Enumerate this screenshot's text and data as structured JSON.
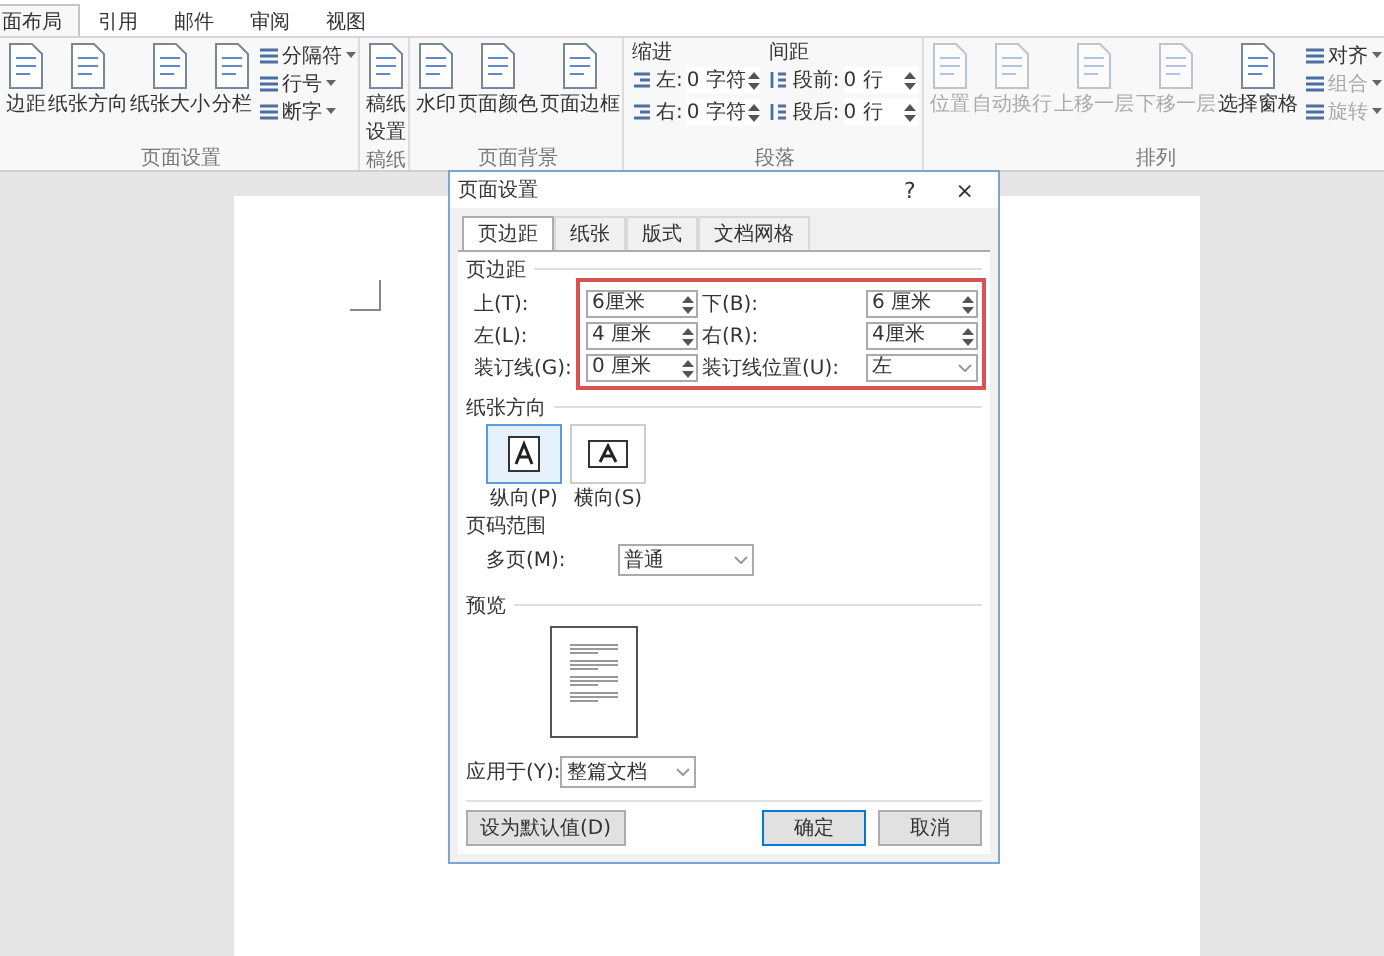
{
  "ribbon_tabs": [
    {
      "label": "面布局",
      "selected": true
    },
    {
      "label": "引用",
      "selected": false
    },
    {
      "label": "邮件",
      "selected": false
    },
    {
      "label": "审阅",
      "selected": false
    },
    {
      "label": "视图",
      "selected": false
    }
  ],
  "ribbon": {
    "page_setup": {
      "title": "页面设置",
      "large": [
        {
          "label": "边距",
          "disabled": false
        },
        {
          "label": "纸张方向",
          "disabled": false
        },
        {
          "label": "纸张大小",
          "disabled": false
        },
        {
          "label": "分栏",
          "disabled": false
        }
      ],
      "small": [
        {
          "label": "分隔符",
          "disabled": false
        },
        {
          "label": "行号",
          "disabled": false
        },
        {
          "label": "断字",
          "disabled": false
        }
      ]
    },
    "manuscript": {
      "title": "稿纸",
      "large": [
        {
          "label": "稿纸设置",
          "disabled": false
        }
      ]
    },
    "page_background": {
      "title": "页面背景",
      "large": [
        {
          "label": "水印",
          "disabled": false
        },
        {
          "label": "页面颜色",
          "disabled": false
        },
        {
          "label": "页面边框",
          "disabled": false
        }
      ]
    },
    "paragraph": {
      "title": "段落",
      "indent_title": "缩进",
      "spacing_title": "间距",
      "indent": [
        {
          "label": "左:",
          "value": "0 字符"
        },
        {
          "label": "右:",
          "value": "0 字符"
        }
      ],
      "spacing": [
        {
          "label": "段前:",
          "value": "0 行"
        },
        {
          "label": "段后:",
          "value": "0 行"
        }
      ]
    },
    "arrange": {
      "title": "排列",
      "large": [
        {
          "label": "位置",
          "disabled": true
        },
        {
          "label": "自动换行",
          "disabled": true
        },
        {
          "label": "上移一层",
          "disabled": true
        },
        {
          "label": "下移一层",
          "disabled": true
        },
        {
          "label": "选择窗格",
          "disabled": false
        }
      ],
      "small": [
        {
          "label": "对齐",
          "disabled": false
        },
        {
          "label": "组合",
          "disabled": true
        },
        {
          "label": "旋转",
          "disabled": true
        }
      ]
    }
  },
  "dialog": {
    "title": "页面设置",
    "help": "?",
    "close": "×",
    "tabs": [
      {
        "label": "页边距",
        "selected": true
      },
      {
        "label": "纸张",
        "selected": false
      },
      {
        "label": "版式",
        "selected": false
      },
      {
        "label": "文档网格",
        "selected": false
      }
    ],
    "margins": {
      "title": "页边距",
      "fields": [
        {
          "label": "上(T):",
          "value": "6厘米",
          "kind": "spin"
        },
        {
          "label": "下(B):",
          "value": "6 厘米",
          "kind": "spin"
        },
        {
          "label": "左(L):",
          "value": "4 厘米",
          "kind": "spin"
        },
        {
          "label": "右(R):",
          "value": "4厘米",
          "kind": "spin"
        },
        {
          "label": "装订线(G):",
          "value": "0 厘米",
          "kind": "spin"
        },
        {
          "label": "装订线位置(U):",
          "value": "左",
          "kind": "select"
        }
      ]
    },
    "orientation": {
      "title": "纸张方向",
      "options": [
        {
          "label": "纵向(P)",
          "selected": true
        },
        {
          "label": "横向(S)",
          "selected": false
        }
      ]
    },
    "pages": {
      "title": "页码范围",
      "label": "多页(M):",
      "value": "普通"
    },
    "preview": {
      "title": "预览"
    },
    "apply": {
      "label": "应用于(Y):",
      "value": "整篇文档"
    },
    "buttons": {
      "default": "设为默认值(D)",
      "ok": "确定",
      "cancel": "取消"
    }
  }
}
